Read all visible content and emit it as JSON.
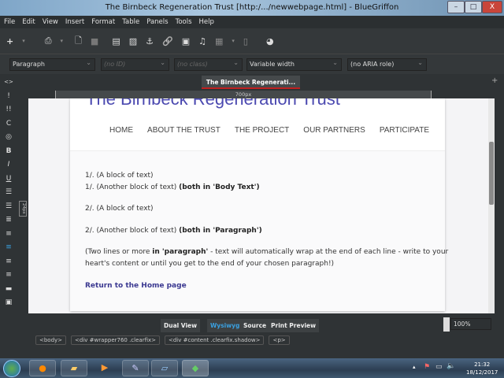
{
  "window": {
    "title": "The Birnbeck Regeneration Trust [http:/.../newwebpage.html] - BlueGriffon",
    "minimize": "–",
    "maximize": "□",
    "close": "X"
  },
  "menu": [
    "File",
    "Edit",
    "View",
    "Insert",
    "Format",
    "Table",
    "Panels",
    "Tools",
    "Help"
  ],
  "toolbar": {
    "icons": [
      "new-icon",
      "open-icon",
      "save-icon",
      "stop-icon",
      "table-icon",
      "image-icon",
      "anchor-icon",
      "link-icon",
      "video-icon",
      "audio-icon",
      "form-icon",
      "doc-icon",
      "globe-icon"
    ],
    "glyphs": [
      "+",
      "▾",
      "⎙",
      "▾",
      "🗋",
      "■",
      "▤",
      "▨",
      "⚓",
      "🔗",
      "▣",
      "♫",
      "▦",
      "▾",
      "▯",
      "◕"
    ]
  },
  "formatbar": {
    "paragraph": "Paragraph",
    "id": "(no ID)",
    "class": "(no class)",
    "width": "Variable width",
    "aria": "(no ARIA role)"
  },
  "tab": {
    "label": "The Birnbeck Regenerati...",
    "add": "+",
    "ruler": "700px",
    "side_ruler": "24px"
  },
  "sidebar": [
    "<>",
    "!",
    "!!",
    "C",
    "◎",
    "B",
    "I",
    "U",
    "☰",
    "☰",
    "≣",
    "≡",
    "≡",
    "≡",
    "≡",
    "▬",
    "▣"
  ],
  "page": {
    "title": "The Birnbeck Regeneration Trust",
    "nav": [
      "HOME",
      "ABOUT THE TRUST",
      "THE PROJECT",
      "OUR PARTNERS",
      "PARTICIPATE"
    ],
    "lines": [
      {
        "t": "1/. (A block of text)",
        "b": ""
      },
      {
        "t": "1/. (Another block of text) ",
        "b": "(both in 'Body Text')"
      },
      {
        "t": "2/. (A block of text)",
        "b": ""
      },
      {
        "t": "2/. (Another block of text) ",
        "b": "(both in 'Paragraph')"
      }
    ],
    "para1_a": "(Two lines or more ",
    "para1_b": "in 'paragraph'",
    "para1_c": " - text will automatically wrap at the end of each line - write to your",
    "para2": "heart's content or until you get to the end of your chosen paragraph!)",
    "link": "Return to the Home page"
  },
  "views": {
    "dual": "Dual View",
    "wysiwyg": "Wysiwyg",
    "source": "Source",
    "print": "Print Preview",
    "zoom": "100%"
  },
  "breadcrumb": [
    "<body>",
    "<div #wrapper760 .clearfix>",
    "<div #content .clearfix.shadow>",
    "<p>"
  ],
  "taskbar": {
    "apps": [
      "firefox-icon",
      "explorer-icon",
      "media-player-icon",
      "paint-icon",
      "notepad-icon",
      "bluegriffon-icon"
    ],
    "time": "21:32",
    "date": "18/12/2017"
  },
  "colors": {
    "accent": "#4b49b0",
    "link": "#3b3991",
    "active_view": "#3aa0e0",
    "tab_underline": "#c02020"
  }
}
